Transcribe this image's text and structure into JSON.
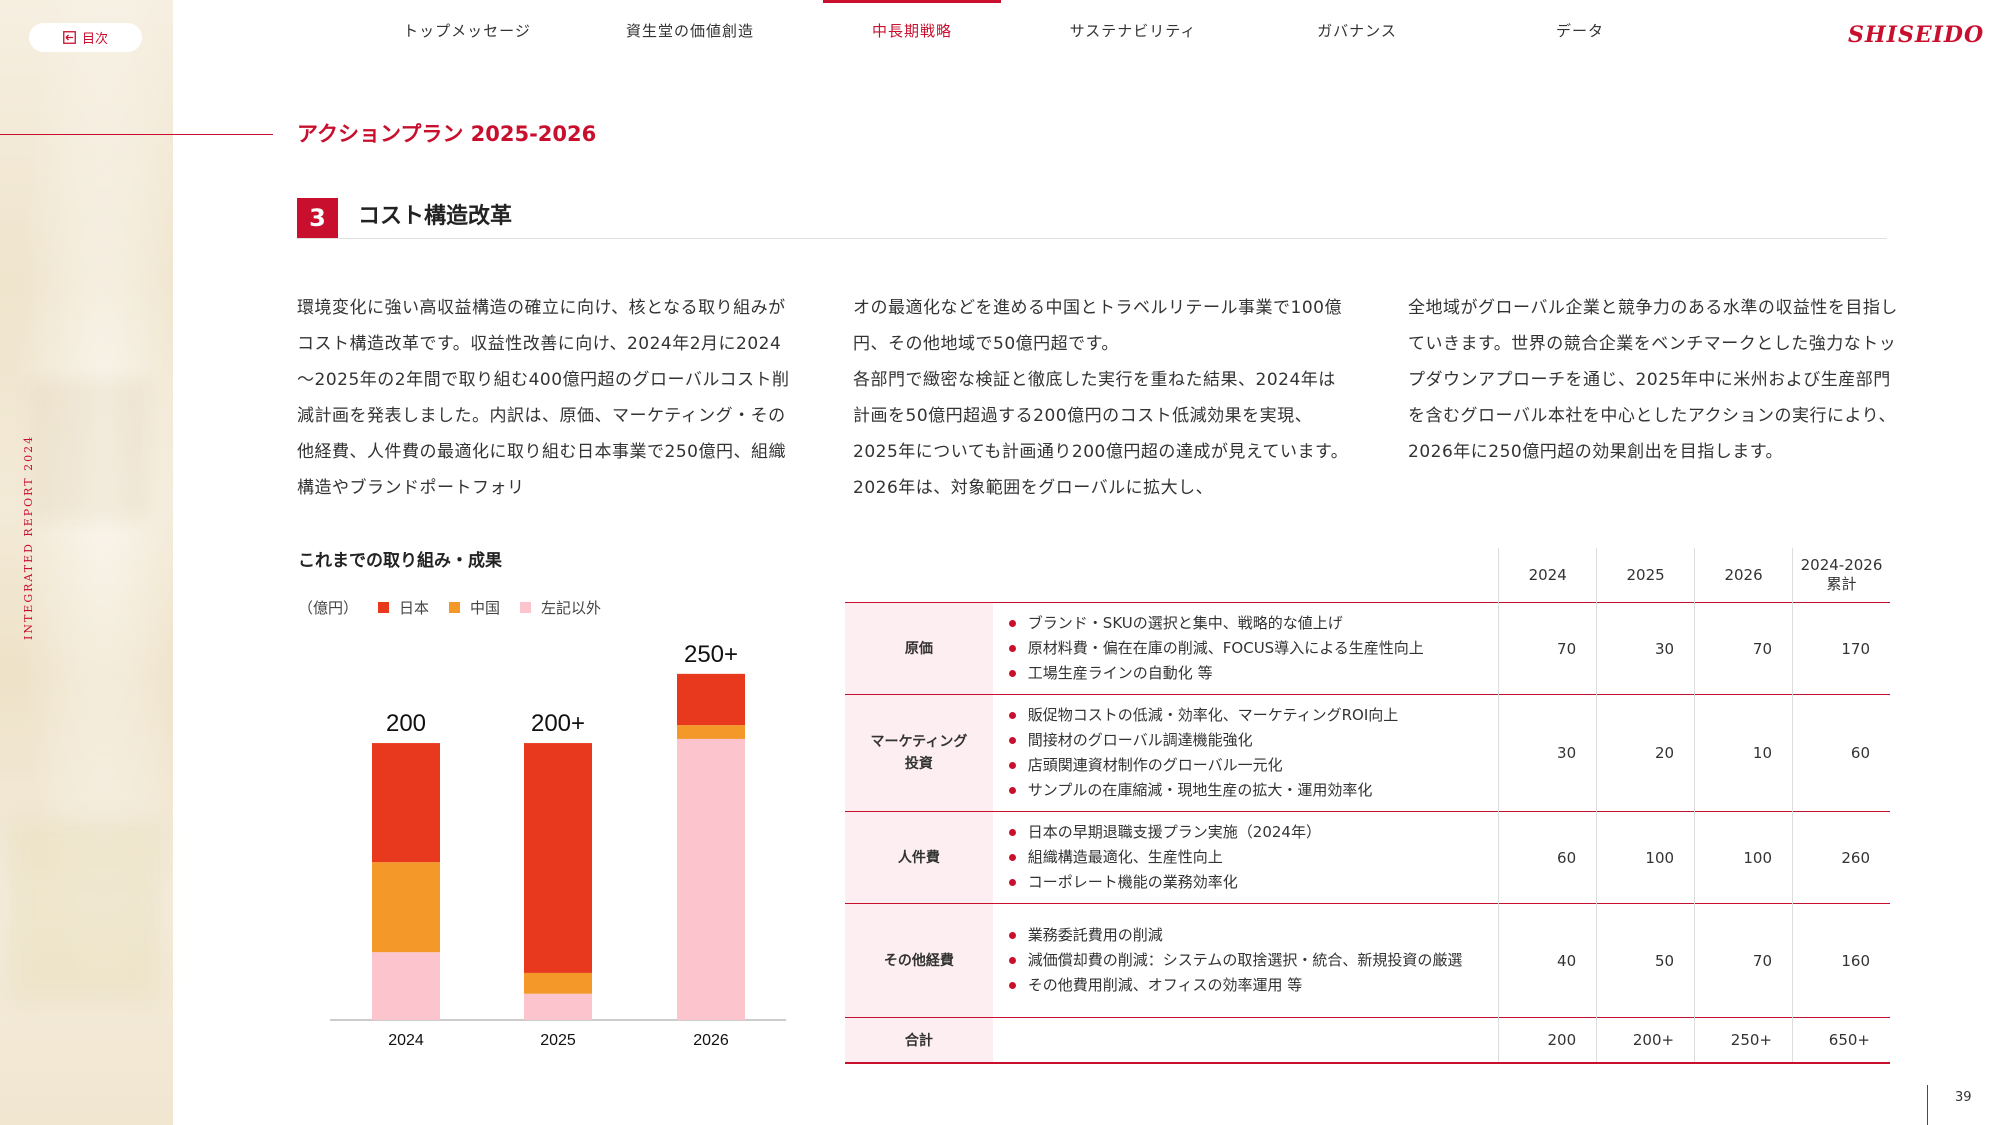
{
  "sidebar": {
    "report_label": "INTEGRATED REPORT 2024"
  },
  "toc": {
    "label": "目次"
  },
  "nav": {
    "items": [
      "トップメッセージ",
      "資生堂の価値創造",
      "中長期戦略",
      "サステナビリティ",
      "ガバナンス",
      "データ"
    ],
    "active_index": 2
  },
  "brand": {
    "logo": "SHISEIDO",
    "accent": "#c8102e"
  },
  "section": {
    "title": "アクションプラン 2025-2026",
    "number": "3",
    "subtitle": "コスト構造改革"
  },
  "body": {
    "col1": "環境変化に強い高収益構造の確立に向け、核となる取り組みがコスト構造改革です。収益性改善に向け、2024年2月に2024～2025年の2年間で取り組む400億円超のグローバルコスト削減計画を発表しました。内訳は、原価、マーケティング・その他経費、人件費の最適化に取り組む日本事業で250億円、組織構造やブランドポートフォリ",
    "col2": "オの最適化などを進める中国とトラベルリテール事業で100億円、その他地域で50億円超です。\n各部門で緻密な検証と徹底した実行を重ねた結果、2024年は計画を50億円超過する200億円のコスト低減効果を実現、2025年についても計画通り200億円超の達成が見えています。2026年は、対象範囲をグローバルに拡大し、",
    "col3": "全地域がグローバル企業と競争力のある水準の収益性を目指していきます。世界の競合企業をベンチマークとした強力なトップダウンアプローチを通じ、2025年中に米州および生産部門を含むグローバル本社を中心としたアクションの実行により、2026年に250億円超の効果創出を目指します。"
  },
  "chart_data": {
    "type": "bar",
    "title": "これまでの取り組み・成果",
    "unit_label": "（億円）",
    "categories": [
      "2024",
      "2025",
      "2026"
    ],
    "series": [
      {
        "name": "日本",
        "color": "#e8381e",
        "values": [
          86,
          166,
          37
        ]
      },
      {
        "name": "中国",
        "color": "#f5982a",
        "values": [
          65,
          15,
          10
        ]
      },
      {
        "name": "左記以外",
        "color": "#fcc4cc",
        "values": [
          49,
          19,
          203
        ]
      }
    ],
    "totals": [
      "200",
      "200+",
      "250+"
    ],
    "ylim": [
      0,
      260
    ],
    "legend_position": "top-left"
  },
  "table": {
    "headers": [
      "2024",
      "2025",
      "2026",
      "2024-2026\n累計"
    ],
    "rows": [
      {
        "category": "原価",
        "items": [
          "ブランド・SKUの選択と集中、戦略的な値上げ",
          "原材料費・偏在在庫の削減、FOCUS導入による生産性向上",
          "工場生産ラインの自動化 等"
        ],
        "values": [
          "70",
          "30",
          "70",
          "170"
        ]
      },
      {
        "category": "マーケティング\n投資",
        "items": [
          "販促物コストの低減・効率化、マーケティングROI向上",
          "間接材のグローバル調達機能強化",
          "店頭関連資材制作のグローバル一元化",
          "サンプルの在庫縮減・現地生産の拡大・運用効率化"
        ],
        "values": [
          "30",
          "20",
          "10",
          "60"
        ]
      },
      {
        "category": "人件費",
        "items": [
          "日本の早期退職支援プラン実施（2024年）",
          "組織構造最適化、生産性向上",
          "コーポレート機能の業務効率化"
        ],
        "values": [
          "60",
          "100",
          "100",
          "260"
        ]
      },
      {
        "category": "その他経費",
        "items": [
          "業務委託費用の削減",
          "減価償却費の削減：システムの取捨選択・統合、新規投資の厳選",
          "その他費用削減、オフィスの効率運用 等"
        ],
        "values": [
          "40",
          "50",
          "70",
          "160"
        ]
      }
    ],
    "total": {
      "label": "合計",
      "values": [
        "200",
        "200+",
        "250+",
        "650+"
      ]
    }
  },
  "page": {
    "number": "39"
  }
}
